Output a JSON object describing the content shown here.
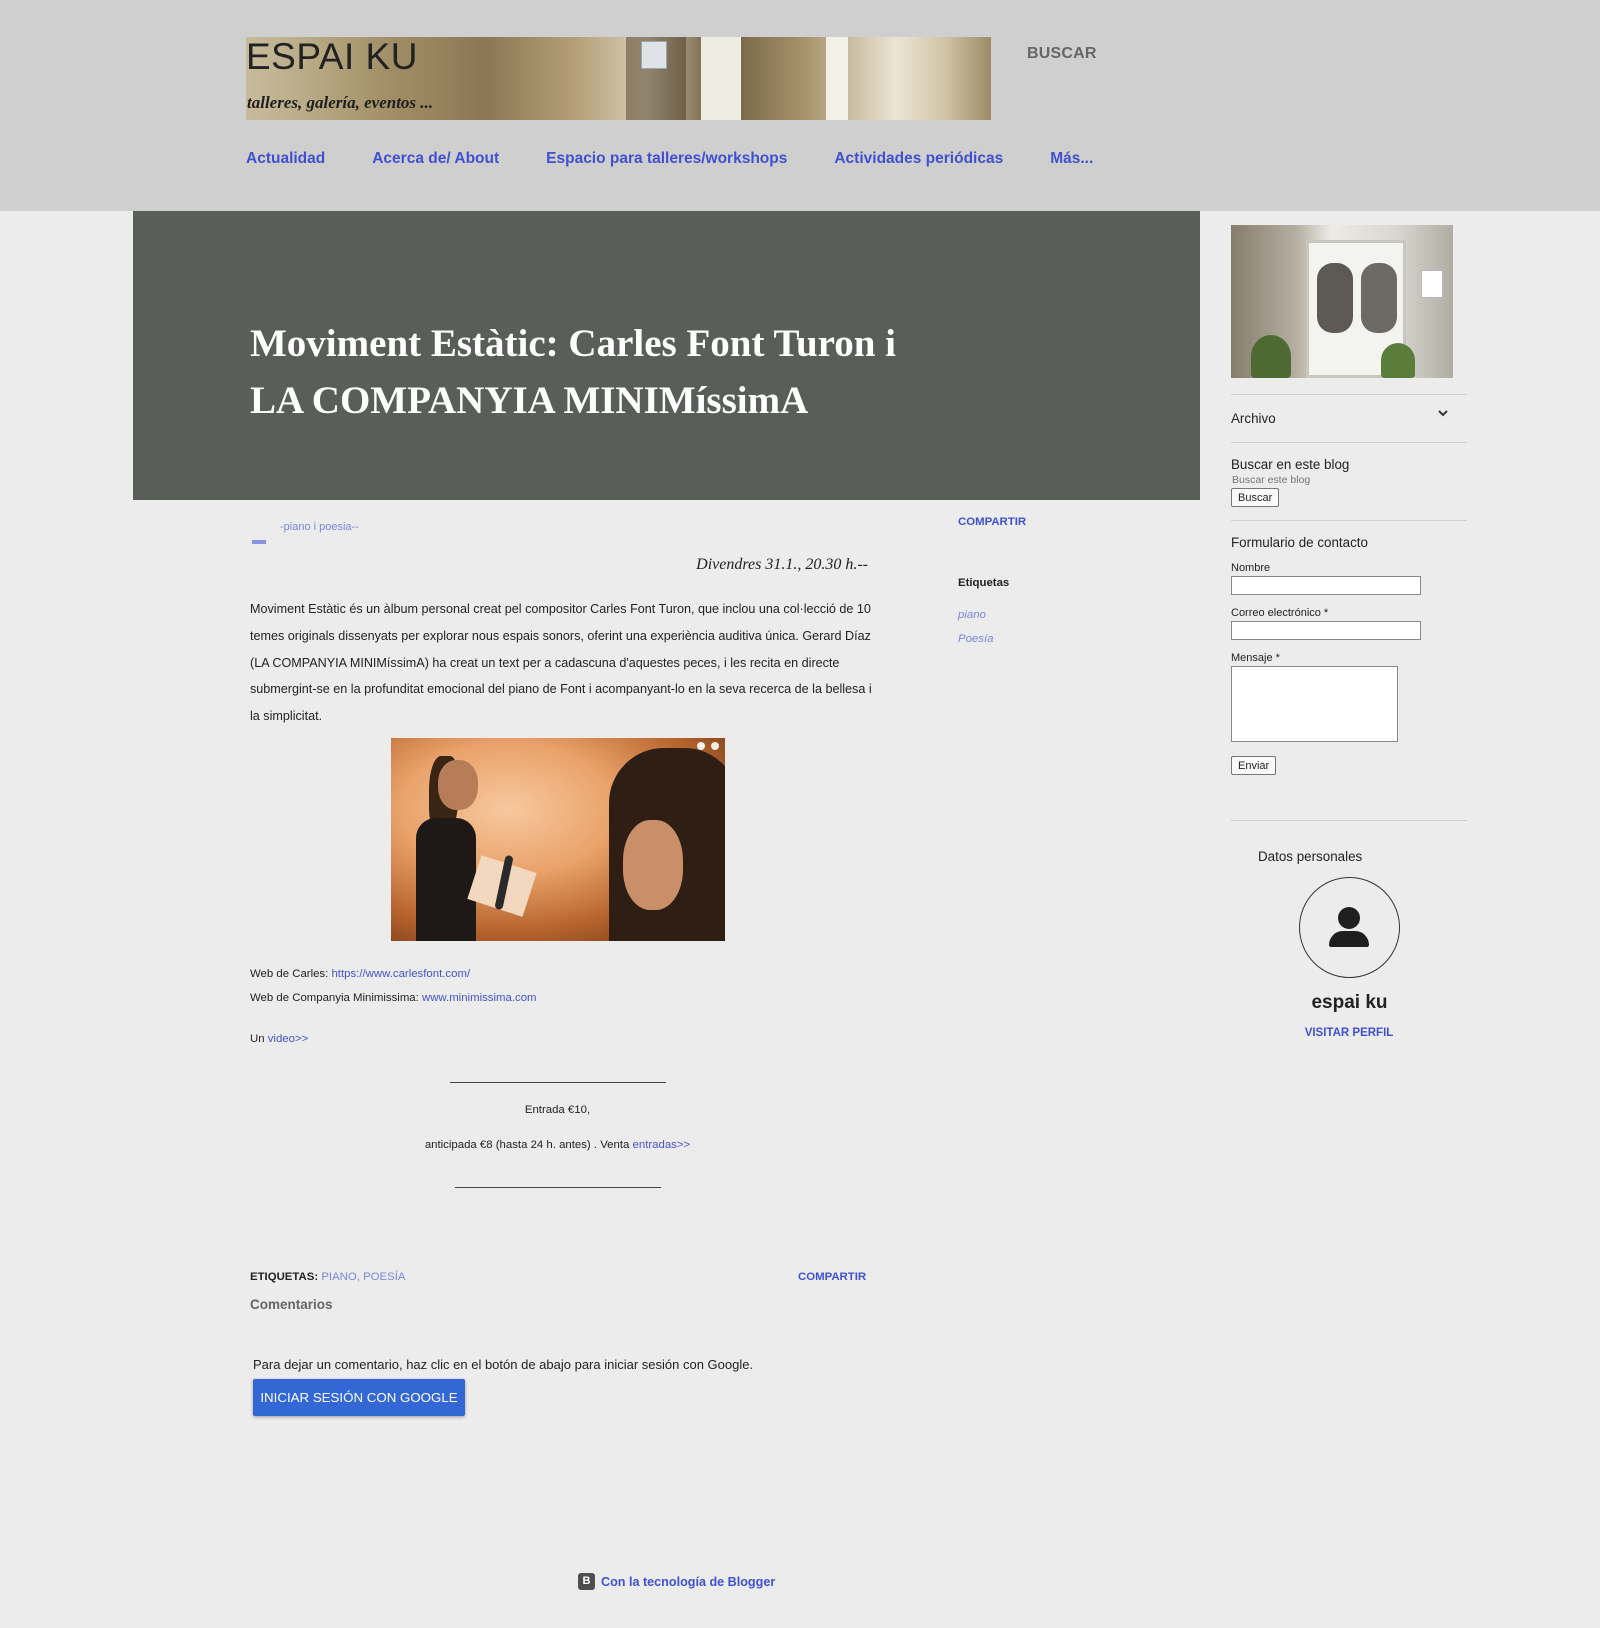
{
  "header": {
    "brand_title": "ESPAI KU",
    "brand_subtitle": "talleres, galería, eventos ...",
    "search_label": "BUSCAR",
    "nav": [
      "Actualidad",
      "Acerca de/ About",
      "Espacio para talleres/workshops",
      "Actividades periódicas",
      "Más..."
    ]
  },
  "post": {
    "title": "Moviment Estàtic: Carles Font Turon i LA COMPANYIA MINIMíssimA",
    "subnote": "-piano i poesia--",
    "date": "Divendres 31.1., 20.30 h.--",
    "body": "Moviment Estàtic és un àlbum personal creat pel compositor Carles Font Turon, que inclou una col·lecció de 10 temes originals dissenyats per explorar nous espais sonors, oferint una experiència auditiva única. Gerard Díaz (LA COMPANYIA MINIMíssimA) ha creat un text per a cadascuna d'aquestes peces, i les recita en directe submergint-se en la profunditat emocional del piano de Font i acompanyant-lo en la seva recerca de la bellesa i la simplicitat.",
    "links": {
      "carles_label": "Web de Carles: ",
      "carles_url": "https://www.carlesfont.com/",
      "minimissima_label": "Web de Companyia Minimissima: ",
      "minimissima_url": "www.minimissima.com"
    },
    "video_prefix": "Un ",
    "video_link": "video>>",
    "entry": "Entrada €10,",
    "presale": "anticipada €8 (hasta 24 h. antes) . Venta ",
    "presale_link": "entradas>>",
    "labels_prefix": "ETIQUETAS:",
    "labels_value": "PIANO, POESÍA",
    "share": "COMPARTIR",
    "comments_title": "Comentarios",
    "comment_note": "Para dejar un comentario, haz clic en el botón de abajo para iniciar sesión con Google.",
    "google_button": "INICIAR SESIÓN CON GOOGLE"
  },
  "post_side": {
    "share": "COMPARTIR",
    "tags_title": "Etiquetas",
    "tags": [
      "piano",
      "Poesía"
    ]
  },
  "sidebar": {
    "archive": "Archivo",
    "search_title": "Buscar en este blog",
    "search_placeholder": "Buscar este blog",
    "search_button": "Buscar",
    "form_title": "Formulario de contacto",
    "name_label": "Nombre",
    "email_label": "Correo electrónico *",
    "message_label": "Mensaje *",
    "send_button": "Enviar",
    "personal_title": "Datos personales",
    "profile_name": "espai ku",
    "profile_link": "VISITAR PERFIL"
  },
  "footer": {
    "text": "Con la tecnología de Blogger"
  },
  "colors": {
    "header_bg": "#cfcfcf",
    "post_band_bg": "#5a5e59",
    "accent": "#3f51d1",
    "google_button": "#3367d6"
  }
}
